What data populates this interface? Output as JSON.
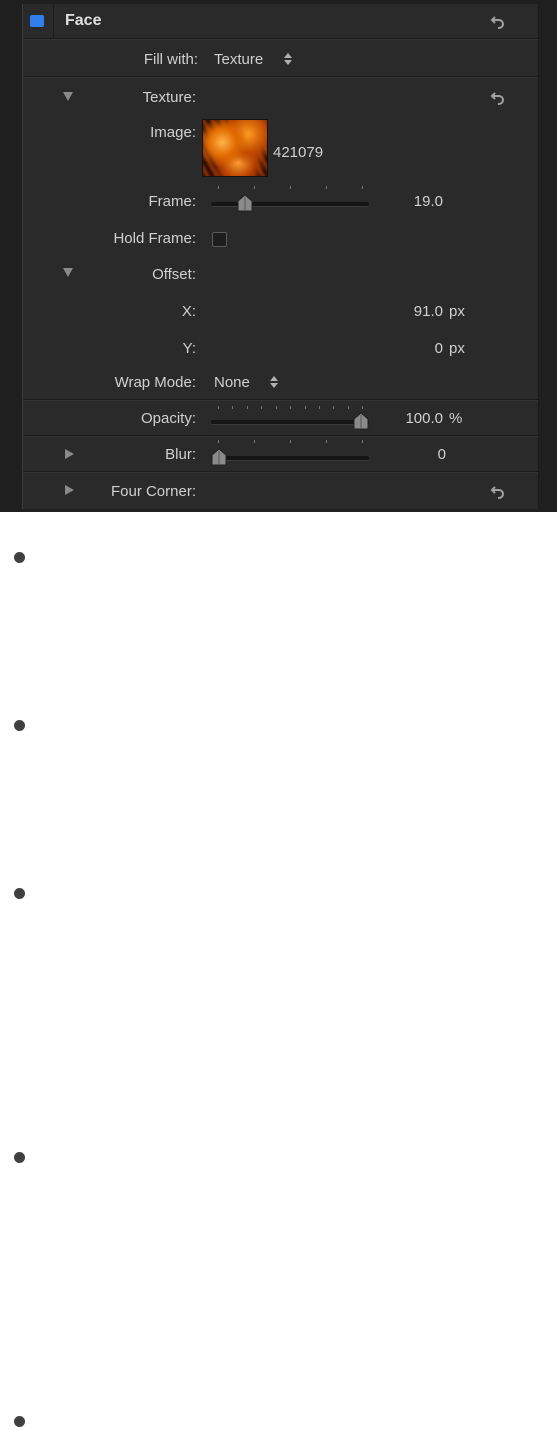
{
  "header": {
    "title": "Face",
    "swatch_color": "#2f80ed"
  },
  "fill_with": {
    "label": "Fill with:",
    "value": "Texture"
  },
  "texture": {
    "label": "Texture:"
  },
  "image": {
    "label": "Image:",
    "name": "421079"
  },
  "frame": {
    "label": "Frame:",
    "value": "19.0",
    "slider_fraction": 0.22
  },
  "hold_frame": {
    "label": "Hold Frame:",
    "checked": false
  },
  "offset": {
    "label": "Offset:"
  },
  "x": {
    "label": "X:",
    "value": "91.0",
    "unit": "px"
  },
  "y": {
    "label": "Y:",
    "value": "0",
    "unit": "px"
  },
  "wrap_mode": {
    "label": "Wrap Mode:",
    "value": "None"
  },
  "opacity": {
    "label": "Opacity:",
    "value": "100.0",
    "unit": "%",
    "slider_fraction": 1.0
  },
  "blur": {
    "label": "Blur:",
    "value": "0",
    "slider_fraction": 0.0
  },
  "four_corner": {
    "label": "Four Corner:"
  },
  "bullets": [
    "",
    "",
    "",
    "",
    ""
  ]
}
